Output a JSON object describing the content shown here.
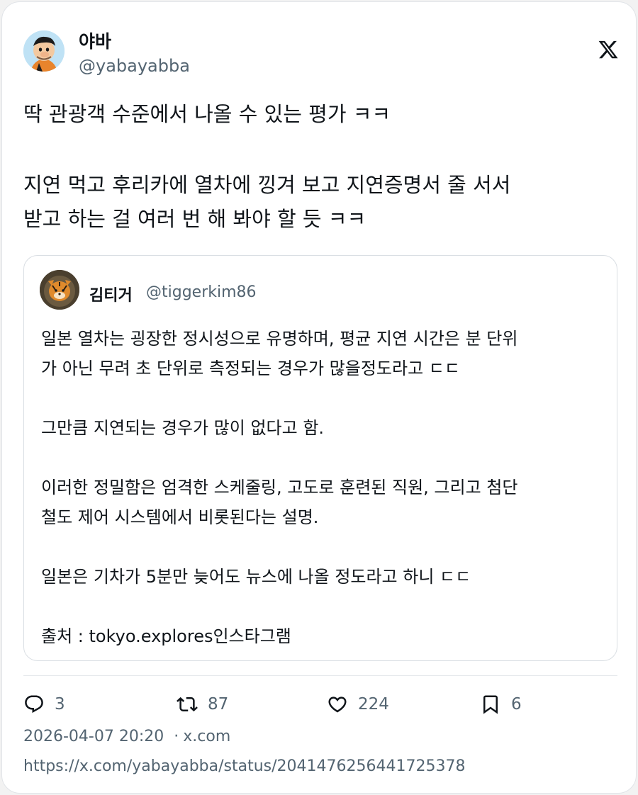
{
  "author": {
    "name": "야바",
    "handle": "@yabayabba"
  },
  "tweet": {
    "lines": [
      "딱 관광객 수준에서 나올 수 있는 평가 ㅋㅋ",
      "지연 먹고 후리카에 열차에 낑겨 보고 지연증명서 줄 서서",
      "받고 하는 걸 여러 번 해 봐야 할 듯 ㅋㅋ"
    ]
  },
  "quote": {
    "name": "김티거",
    "handle": "@tiggerkim86",
    "lines": [
      "일본 열차는 굉장한 정시성으로 유명하며, 평균 지연 시간은 분 단위",
      "가 아닌 무려 초 단위로 측정되는 경우가 많을정도라고 ㄷㄷ",
      "그만큼 지연되는 경우가 많이 없다고 함.",
      "이러한 정밀함은 엄격한 스케줄링, 고도로 훈련된 직원, 그리고 첨단",
      "철도 제어 시스템에서 비롯된다는 설명.",
      "일본은 기차가 5분만 늦어도 뉴스에 나올 정도라고 하니 ㄷㄷ",
      "출처 : tokyo.explores인스타그램"
    ]
  },
  "actions": {
    "replies": "3",
    "reposts": "87",
    "likes": "224",
    "bookmarks": "6"
  },
  "meta": {
    "timestamp": "2026-04-07 20:20",
    "source": "x.com",
    "url": "https://x.com/yabayabba/status/2041476256441725378"
  },
  "icons": {
    "brand": "x-logo-icon",
    "reply": "reply-icon",
    "repost": "repost-icon",
    "like": "heart-icon",
    "bookmark": "bookmark-icon"
  },
  "colors": {
    "text": "#0f1419",
    "secondary": "#536471",
    "border": "#d9dee3"
  }
}
